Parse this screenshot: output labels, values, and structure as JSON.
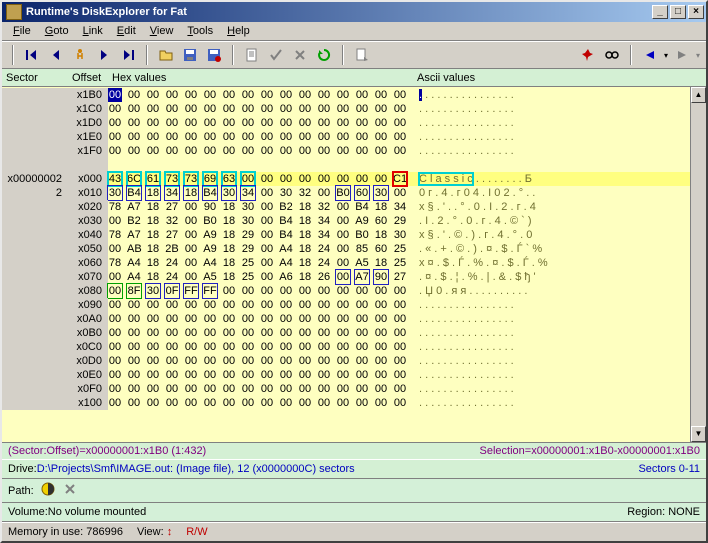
{
  "window": {
    "title": "Runtime's DiskExplorer for Fat"
  },
  "menu": {
    "file": "File",
    "goto": "Goto",
    "link": "Link",
    "edit": "Edit",
    "view": "View",
    "tools": "Tools",
    "help": "Help"
  },
  "headers": {
    "sector": "Sector",
    "offset": "Offset",
    "hex": "Hex values",
    "ascii": "Ascii values"
  },
  "rows": [
    {
      "sector": "",
      "offset": "x1B0",
      "hex": [
        "00",
        "00",
        "00",
        "00",
        "00",
        "00",
        "00",
        "00",
        "00",
        "00",
        "00",
        "00",
        "00",
        "00",
        "00",
        "00"
      ],
      "ascii": ". . . . . . . . . . . . . . . .",
      "hl": false,
      "first_sel": true
    },
    {
      "sector": "",
      "offset": "x1C0",
      "hex": [
        "00",
        "00",
        "00",
        "00",
        "00",
        "00",
        "00",
        "00",
        "00",
        "00",
        "00",
        "00",
        "00",
        "00",
        "00",
        "00"
      ],
      "ascii": ". . . . . . . . . . . . . . . .",
      "hl": false
    },
    {
      "sector": "",
      "offset": "x1D0",
      "hex": [
        "00",
        "00",
        "00",
        "00",
        "00",
        "00",
        "00",
        "00",
        "00",
        "00",
        "00",
        "00",
        "00",
        "00",
        "00",
        "00"
      ],
      "ascii": ". . . . . . . . . . . . . . . .",
      "hl": false
    },
    {
      "sector": "",
      "offset": "x1E0",
      "hex": [
        "00",
        "00",
        "00",
        "00",
        "00",
        "00",
        "00",
        "00",
        "00",
        "00",
        "00",
        "00",
        "00",
        "00",
        "00",
        "00"
      ],
      "ascii": ". . . . . . . . . . . . . . . .",
      "hl": false
    },
    {
      "sector": "",
      "offset": "x1F0",
      "hex": [
        "00",
        "00",
        "00",
        "00",
        "00",
        "00",
        "00",
        "00",
        "00",
        "00",
        "00",
        "00",
        "00",
        "00",
        "00",
        "00"
      ],
      "ascii": ". . . . . . . . . . . . . . . .",
      "hl": false
    },
    {
      "sector": "",
      "offset": "",
      "hex": [],
      "ascii": "",
      "blank": true
    },
    {
      "sector": "x00000002",
      "offset": "x000",
      "hex": [
        "43",
        "6C",
        "61",
        "73",
        "73",
        "69",
        "63",
        "00",
        "00",
        "00",
        "00",
        "00",
        "00",
        "00",
        "00",
        "C1"
      ],
      "ascii": "C l a s s i c . . . . . . . . Б",
      "hl": true,
      "cyanBox": [
        0,
        7
      ],
      "redBox": [
        15,
        15
      ]
    },
    {
      "sector": "2",
      "offset": "x010",
      "hex": [
        "30",
        "B4",
        "18",
        "34",
        "18",
        "B4",
        "30",
        "34",
        "00",
        "30",
        "32",
        "00",
        "B0",
        "60",
        "30",
        "00"
      ],
      "ascii": "0 г . 4 . г 0 4 . I 0 2 . ° . .",
      "bluBox": [
        [
          0,
          7
        ],
        [
          12,
          14
        ]
      ]
    },
    {
      "sector": "",
      "offset": "x020",
      "hex": [
        "78",
        "A7",
        "18",
        "27",
        "00",
        "90",
        "18",
        "30",
        "00",
        "B2",
        "18",
        "32",
        "00",
        "B4",
        "18",
        "34"
      ],
      "ascii": "x § . ' . . ° . 0 . I . 2 . г . 4"
    },
    {
      "sector": "",
      "offset": "x030",
      "hex": [
        "00",
        "B2",
        "18",
        "32",
        "00",
        "B0",
        "18",
        "30",
        "00",
        "B4",
        "18",
        "34",
        "00",
        "A9",
        "60",
        "29"
      ],
      "ascii": ". I . 2 . ° . 0 . г . 4 . © ` )"
    },
    {
      "sector": "",
      "offset": "x040",
      "hex": [
        "78",
        "A7",
        "18",
        "27",
        "00",
        "A9",
        "18",
        "29",
        "00",
        "B4",
        "18",
        "34",
        "00",
        "B0",
        "18",
        "30"
      ],
      "ascii": "x § . ' . © . ) . г . 4 . ° . 0"
    },
    {
      "sector": "",
      "offset": "x050",
      "hex": [
        "00",
        "AB",
        "18",
        "2B",
        "00",
        "A9",
        "18",
        "29",
        "00",
        "A4",
        "18",
        "24",
        "00",
        "85",
        "60",
        "25"
      ],
      "ascii": ". « . + . © . ) . ¤ . $ . Ѓ ` %"
    },
    {
      "sector": "",
      "offset": "x060",
      "hex": [
        "78",
        "A4",
        "18",
        "24",
        "00",
        "A4",
        "18",
        "25",
        "00",
        "A4",
        "18",
        "24",
        "00",
        "A5",
        "18",
        "25"
      ],
      "ascii": "x ¤ . $ . Ѓ . % . ¤ . $ . Ѓ . %"
    },
    {
      "sector": "",
      "offset": "x070",
      "hex": [
        "00",
        "A4",
        "18",
        "24",
        "00",
        "A5",
        "18",
        "25",
        "00",
        "A6",
        "18",
        "26",
        "00",
        "A7",
        "90",
        "27"
      ],
      "ascii": ". ¤ . $ . ¦ . % . | . & . $ ђ '",
      "bluBox": [
        [
          12,
          14
        ]
      ]
    },
    {
      "sector": "",
      "offset": "x080",
      "hex": [
        "00",
        "8F",
        "30",
        "0F",
        "FF",
        "FF",
        "00",
        "00",
        "00",
        "00",
        "00",
        "00",
        "00",
        "00",
        "00",
        "00"
      ],
      "ascii": ". Џ 0 . я я . . . . . . . . . .",
      "grnBox": [
        [
          0,
          1
        ]
      ],
      "bluBox": [
        [
          2,
          3
        ],
        [
          4,
          5
        ]
      ]
    },
    {
      "sector": "",
      "offset": "x090",
      "hex": [
        "00",
        "00",
        "00",
        "00",
        "00",
        "00",
        "00",
        "00",
        "00",
        "00",
        "00",
        "00",
        "00",
        "00",
        "00",
        "00"
      ],
      "ascii": ". . . . . . . . . . . . . . . ."
    },
    {
      "sector": "",
      "offset": "x0A0",
      "hex": [
        "00",
        "00",
        "00",
        "00",
        "00",
        "00",
        "00",
        "00",
        "00",
        "00",
        "00",
        "00",
        "00",
        "00",
        "00",
        "00"
      ],
      "ascii": ". . . . . . . . . . . . . . . ."
    },
    {
      "sector": "",
      "offset": "x0B0",
      "hex": [
        "00",
        "00",
        "00",
        "00",
        "00",
        "00",
        "00",
        "00",
        "00",
        "00",
        "00",
        "00",
        "00",
        "00",
        "00",
        "00"
      ],
      "ascii": ". . . . . . . . . . . . . . . ."
    },
    {
      "sector": "",
      "offset": "x0C0",
      "hex": [
        "00",
        "00",
        "00",
        "00",
        "00",
        "00",
        "00",
        "00",
        "00",
        "00",
        "00",
        "00",
        "00",
        "00",
        "00",
        "00"
      ],
      "ascii": ". . . . . . . . . . . . . . . ."
    },
    {
      "sector": "",
      "offset": "x0D0",
      "hex": [
        "00",
        "00",
        "00",
        "00",
        "00",
        "00",
        "00",
        "00",
        "00",
        "00",
        "00",
        "00",
        "00",
        "00",
        "00",
        "00"
      ],
      "ascii": ". . . . . . . . . . . . . . . ."
    },
    {
      "sector": "",
      "offset": "x0E0",
      "hex": [
        "00",
        "00",
        "00",
        "00",
        "00",
        "00",
        "00",
        "00",
        "00",
        "00",
        "00",
        "00",
        "00",
        "00",
        "00",
        "00"
      ],
      "ascii": ". . . . . . . . . . . . . . . ."
    },
    {
      "sector": "",
      "offset": "x0F0",
      "hex": [
        "00",
        "00",
        "00",
        "00",
        "00",
        "00",
        "00",
        "00",
        "00",
        "00",
        "00",
        "00",
        "00",
        "00",
        "00",
        "00"
      ],
      "ascii": ". . . . . . . . . . . . . . . ."
    },
    {
      "sector": "",
      "offset": "x100",
      "hex": [
        "00",
        "00",
        "00",
        "00",
        "00",
        "00",
        "00",
        "00",
        "00",
        "00",
        "00",
        "00",
        "00",
        "00",
        "00",
        "00"
      ],
      "ascii": ". . . . . . . . . . . . . . . ."
    }
  ],
  "status": {
    "pos": "(Sector:Offset)=x00000001:x1B0 (1:432)",
    "sel": "Selection=x00000001:x1B0-x00000001:x1B0"
  },
  "drive": {
    "label": "Drive: ",
    "path": "D:\\Projects\\Smf\\IMAGE.out: (Image file), 12 (x0000000C) sectors",
    "sectors": "Sectors 0-11"
  },
  "pathline": {
    "label": "Path:"
  },
  "volline": {
    "label": "Volume: ",
    "value": "No volume mounted",
    "region_label": "Region: ",
    "region": "NONE"
  },
  "bottom": {
    "mem": "Memory in use: 786996",
    "vlabel": "View:",
    "rw": "R/W"
  }
}
